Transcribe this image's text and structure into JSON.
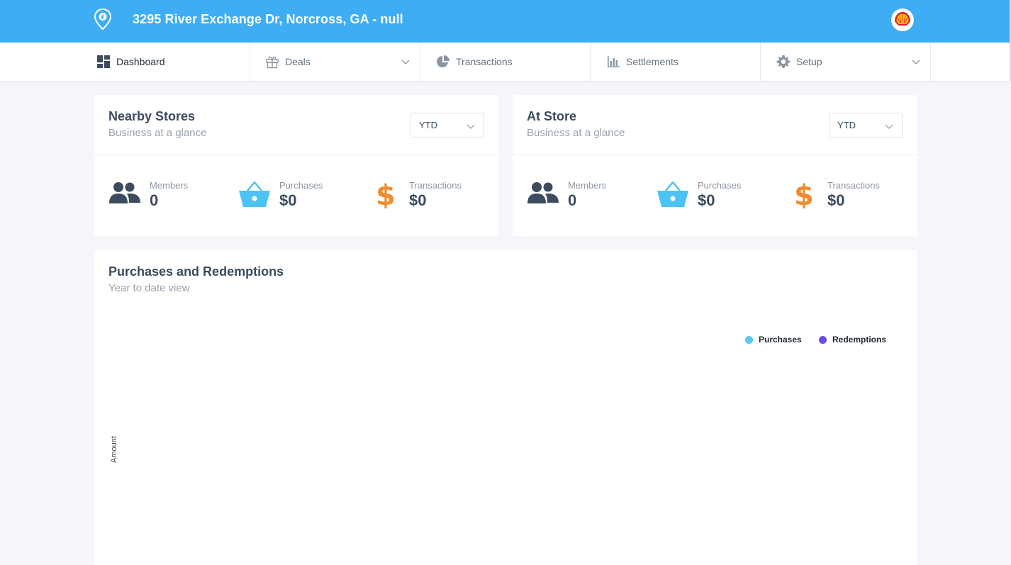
{
  "header": {
    "title": "3295 River Exchange Dr, Norcross, GA - null",
    "accent_color": "#3fadf4",
    "location_icon": "map-pin-icon",
    "brand_logo": "shell-logo"
  },
  "nav": {
    "items": [
      {
        "label": "Dashboard",
        "icon": "dashboard-icon",
        "active": true
      },
      {
        "label": "Deals",
        "icon": "gift-icon",
        "has_dropdown": true
      },
      {
        "label": "Transactions",
        "icon": "pie-chart-icon"
      },
      {
        "label": "Settlements",
        "icon": "bar-chart-icon"
      },
      {
        "label": "Setup",
        "icon": "gear-icon",
        "has_dropdown": true
      }
    ]
  },
  "nearby": {
    "title": "Nearby Stores",
    "subtitle": "Business at a glance",
    "period": "YTD",
    "stats": [
      {
        "label": "Members",
        "value": "0",
        "icon": "users-icon"
      },
      {
        "label": "Purchases",
        "value": "$0",
        "icon": "basket-icon"
      },
      {
        "label": "Transactions",
        "value": "$0",
        "icon": "dollar-icon"
      }
    ]
  },
  "atstore": {
    "title": "At Store",
    "subtitle": "Business at a glance",
    "period": "YTD",
    "stats": [
      {
        "label": "Members",
        "value": "0",
        "icon": "users-icon"
      },
      {
        "label": "Purchases",
        "value": "$0",
        "icon": "basket-icon"
      },
      {
        "label": "Transactions",
        "value": "$0",
        "icon": "dollar-icon"
      }
    ]
  },
  "chart": {
    "title": "Purchases and Redemptions",
    "subtitle": "Year to date view"
  },
  "chart_data": {
    "type": "line",
    "title": "",
    "xlabel": "",
    "ylabel": "Amount",
    "legend_position": "top-right",
    "series": [
      {
        "name": "Purchases",
        "color": "#5bc8f5",
        "values": []
      },
      {
        "name": "Redemptions",
        "color": "#6a4be8",
        "values": []
      }
    ]
  },
  "colors": {
    "icon_dark": "#3c4b5e",
    "basket": "#4cc3f5",
    "dollar": "#f08b2e"
  }
}
